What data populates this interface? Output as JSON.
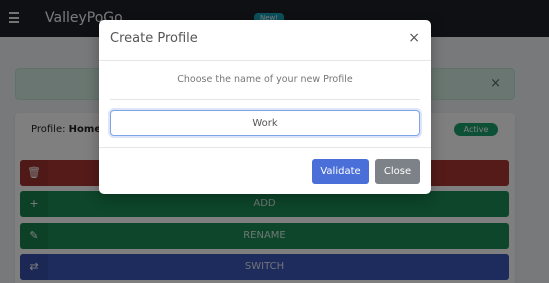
{
  "navbar": {
    "menu_icon": "hamburger-icon",
    "brand": "ValleyPoGo",
    "badge": "New!"
  },
  "alert": {
    "close_glyph": "×"
  },
  "card": {
    "profile_label": "Profile:",
    "profile_name": "Home",
    "status": "Active"
  },
  "actions": {
    "delete_icon": "trash-icon",
    "delete_label": "",
    "add_icon": "plus-icon",
    "add_label": "ADD",
    "rename_icon": "edit-icon",
    "rename_label": "RENAME",
    "switch_icon": "shuffle-icon",
    "switch_label": "SWITCH"
  },
  "modal": {
    "title": "Create Profile",
    "close_glyph": "×",
    "prompt": "Choose the name of your new Profile",
    "input_value": "Work",
    "validate_label": "Validate",
    "close_label": "Close"
  },
  "colors": {
    "navbar": "#1e2126",
    "delete": "#a93633",
    "add": "#1a8c57",
    "rename": "#1a8c57",
    "switch": "#3b58b8",
    "active_badge": "#19a06a",
    "validate": "#4a6fd8",
    "close": "#7c8288"
  }
}
